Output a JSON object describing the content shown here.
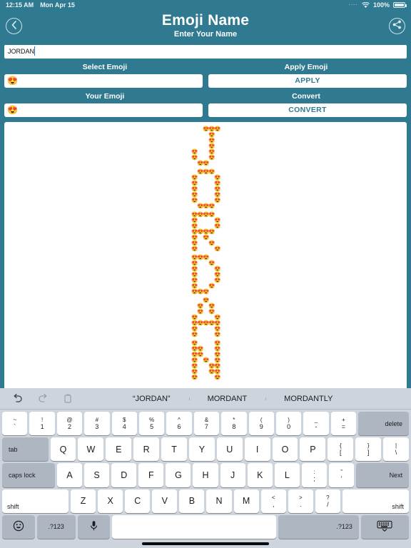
{
  "status_bar": {
    "time": "12:15 AM",
    "date": "Mon Apr 15",
    "dots": "····",
    "wifi_icon": "wifi-icon",
    "battery_percent": "100%",
    "battery_icon": "battery-full-icon"
  },
  "header": {
    "back_icon": "chevron-left-icon",
    "title": "Emoji Name",
    "subtitle": "Enter Your Name",
    "share_icon": "share-icon"
  },
  "name_field": {
    "value": "JORDAN",
    "placeholder": "Enter Your Name"
  },
  "labels": {
    "select_emoji": "Select Emoji",
    "apply_emoji": "Apply Emoji",
    "your_emoji": "Your Emoji",
    "convert": "Convert"
  },
  "fields": {
    "select_emoji_value": "😍",
    "your_emoji_value": "😍",
    "apply_button": "APPLY",
    "convert_button": "CONVERT"
  },
  "canvas": {
    "emoji": "😍",
    "text": "JORDAN",
    "letters": [
      {
        "char": "J",
        "rows": [
          "..XXX",
          "...X.",
          "...X.",
          "...X.",
          "X..X.",
          "X..X.",
          ".XX.."
        ]
      },
      {
        "char": "O",
        "rows": [
          ".XXX.",
          "X...X",
          "X...X",
          "X...X",
          "X...X",
          "X...X",
          ".XXX."
        ]
      },
      {
        "char": "R",
        "rows": [
          "XXXX.",
          "X...X",
          "X...X",
          "XXXX.",
          "X.X..",
          "X..X.",
          "X...X"
        ]
      },
      {
        "char": "D",
        "rows": [
          "XXX..",
          "X..X.",
          "X...X",
          "X...X",
          "X...X",
          "X..X.",
          "XXX.."
        ]
      },
      {
        "char": "A",
        "rows": [
          "..X..",
          ".X.X.",
          ".X.X.",
          "X...X",
          "XXXXX",
          "X...X",
          "X...X"
        ]
      },
      {
        "char": "N",
        "rows": [
          "X...X",
          "XX..X",
          "XX..X",
          "X.X.X",
          "X..XX",
          "X..XX",
          "X...X"
        ]
      }
    ]
  },
  "keyboard": {
    "predictions": {
      "undo_icon": "undo-icon",
      "redo_icon": "redo-icon",
      "paste_icon": "paste-icon",
      "words": [
        "“JORDAN”",
        "MORDANT",
        "MORDANTLY"
      ]
    },
    "row_numbers": [
      {
        "upper": "~",
        "lower": "`"
      },
      {
        "upper": "!",
        "lower": "1"
      },
      {
        "upper": "@",
        "lower": "2"
      },
      {
        "upper": "#",
        "lower": "3"
      },
      {
        "upper": "$",
        "lower": "4"
      },
      {
        "upper": "%",
        "lower": "5"
      },
      {
        "upper": "^",
        "lower": "6"
      },
      {
        "upper": "&",
        "lower": "7"
      },
      {
        "upper": "*",
        "lower": "8"
      },
      {
        "upper": "(",
        "lower": "9"
      },
      {
        "upper": ")",
        "lower": "0"
      },
      {
        "upper": "_",
        "lower": "-"
      },
      {
        "upper": "+",
        "lower": "="
      }
    ],
    "delete_label": "delete",
    "tab_label": "tab",
    "row_q": [
      "Q",
      "W",
      "E",
      "R",
      "T",
      "Y",
      "U",
      "I",
      "O",
      "P"
    ],
    "row_q_extra": [
      {
        "upper": "{",
        "lower": "["
      },
      {
        "upper": "}",
        "lower": "]"
      },
      {
        "upper": "|",
        "lower": "\\"
      }
    ],
    "caps_label": "caps lock",
    "row_a": [
      "A",
      "S",
      "D",
      "F",
      "G",
      "H",
      "J",
      "K",
      "L"
    ],
    "row_a_extra": [
      {
        "upper": ":",
        "lower": ";"
      },
      {
        "upper": "”",
        "lower": "’"
      }
    ],
    "next_label": "Next",
    "shift_label": "shift",
    "row_z": [
      "Z",
      "X",
      "C",
      "V",
      "B",
      "N",
      "M"
    ],
    "row_z_extra": [
      {
        "upper": "<",
        "lower": ","
      },
      {
        "upper": ">",
        "lower": "."
      },
      {
        "upper": "?",
        "lower": "/"
      }
    ],
    "emoji_key_icon": "emoji-smiley-icon",
    "numeric_left_label": ".?123",
    "mic_icon": "microphone-icon",
    "space_label": "",
    "numeric_right_label": ".?123",
    "dismiss_icon": "keyboard-dismiss-icon"
  },
  "colors": {
    "brand_teal": "#2f7a90",
    "key_white": "#ffffff",
    "key_dark": "#aeb7c1",
    "keyboard_bg": "#cdd4dc",
    "emoji_orange": "#f5a623"
  }
}
